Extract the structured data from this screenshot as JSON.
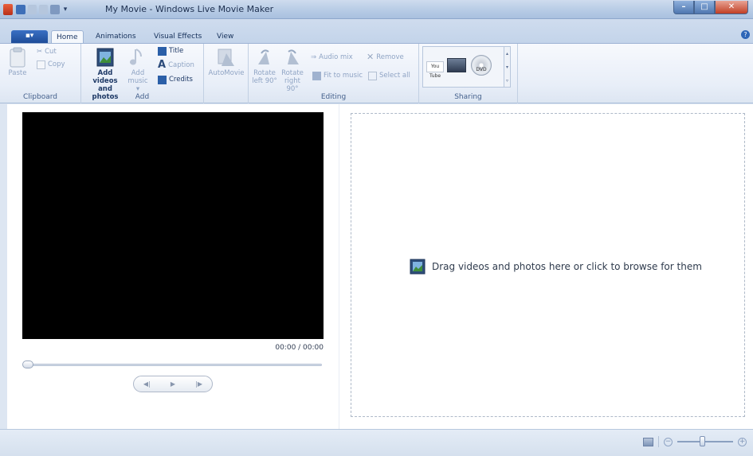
{
  "window": {
    "title": "My Movie - Windows Live Movie Maker",
    "min_glyph": "–",
    "max_glyph": "□",
    "close_glyph": "✕"
  },
  "tabs": {
    "app_menu": "▪▾",
    "items": [
      "Home",
      "Animations",
      "Visual Effects",
      "View"
    ],
    "active": "Home",
    "help": "?"
  },
  "ribbon": {
    "clipboard": {
      "label": "Clipboard",
      "paste": "Paste",
      "cut": "Cut",
      "copy": "Copy"
    },
    "add": {
      "label": "Add",
      "add_videos_line1": "Add videos",
      "add_videos_line2": "and photos",
      "add_music_line1": "Add",
      "add_music_line2": "music ▾",
      "title": "Title",
      "caption": "Caption",
      "credits": "Credits"
    },
    "automovie": {
      "label": "AutoMovie"
    },
    "editing": {
      "label": "Editing",
      "rotate_left_line1": "Rotate",
      "rotate_left_line2": "left 90°",
      "rotate_right_line1": "Rotate",
      "rotate_right_line2": "right 90°",
      "audio_mix": "Audio mix",
      "remove": "Remove",
      "fit_to_music": "Fit to music",
      "select_all": "Select all"
    },
    "sharing": {
      "label": "Sharing",
      "youtube": "You Tube",
      "dvd": "DVD"
    }
  },
  "preview": {
    "timecode": "00:00 / 00:00",
    "prev_frame": "◀|",
    "play": "▶",
    "next_frame": "|▶"
  },
  "storyboard": {
    "message": "Drag videos and photos here or click to browse for them"
  },
  "statusbar": {
    "zoom_out": "−",
    "zoom_in": "+",
    "zoom_level": 0.45
  }
}
